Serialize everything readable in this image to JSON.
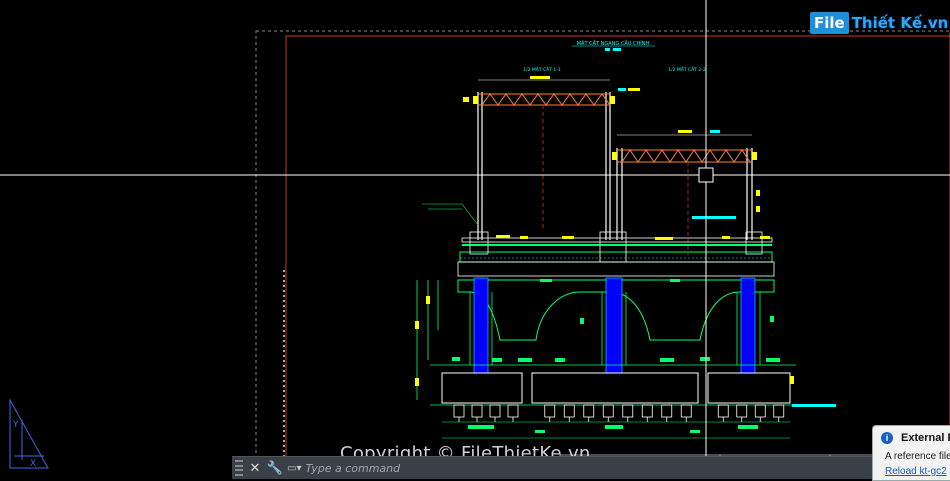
{
  "watermark": "Copyright © FileThietKe.vn",
  "logo": {
    "box": "File",
    "text": "Thiết Kế.vn"
  },
  "drawing": {
    "title": "MẶT CẮT NGANG CẦU CHÍNH",
    "left_label": "1/2 MẶT CẮT 1-1",
    "right_label": "1/2 MẶT CẮT 2-2"
  },
  "command_line": {
    "placeholder": "Type a command",
    "close_icon": "close-icon",
    "settings_icon": "wrench-icon"
  },
  "notification": {
    "title": "External R",
    "body": "A reference file",
    "link": "Reload kt-gc2"
  },
  "colors": {
    "background": "#000000",
    "crosshair": "#ffffff",
    "frame": "#c8322a",
    "steel": "#ff7f3a",
    "pier": "#0000ff",
    "outline": "#00ff66",
    "dim": "#ffffff",
    "tag": "#ffff00",
    "cyan": "#00ffff"
  }
}
